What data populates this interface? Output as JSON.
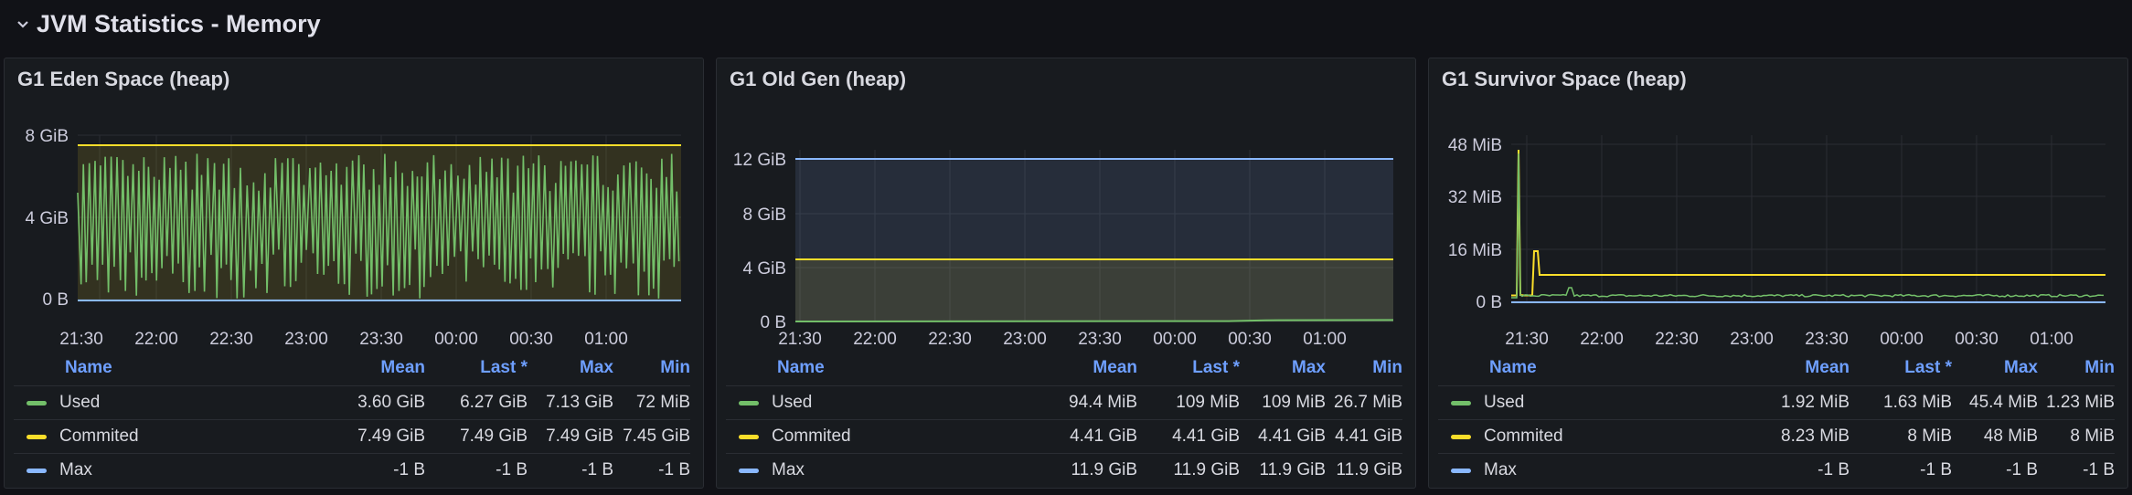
{
  "row": {
    "title": "JVM Statistics - Memory",
    "collapse_icon": "chevron-down-icon"
  },
  "legend_headers": {
    "name": "Name",
    "mean": "Mean",
    "last": "Last *",
    "max": "Max",
    "min": "Min"
  },
  "colors": {
    "used": "#73bf69",
    "commited": "#fade2a",
    "max": "#8ab8ff",
    "grid": "#2a2d33",
    "bg": "#181b1f"
  },
  "x_ticks": [
    "21:30",
    "22:00",
    "22:30",
    "23:00",
    "23:30",
    "00:00",
    "00:30",
    "01:00"
  ],
  "panels": [
    {
      "title": "G1 Eden Space (heap)",
      "y_ticks": [
        "8 GiB",
        "4 GiB",
        "0 B"
      ],
      "rows": [
        {
          "name": "Used",
          "mean": "3.60 GiB",
          "last": "6.27 GiB",
          "max": "7.13 GiB",
          "min": "72 MiB"
        },
        {
          "name": "Commited",
          "mean": "7.49 GiB",
          "last": "7.49 GiB",
          "max": "7.49 GiB",
          "min": "7.45 GiB"
        },
        {
          "name": "Max",
          "mean": "-1 B",
          "last": "-1 B",
          "max": "-1 B",
          "min": "-1 B"
        }
      ]
    },
    {
      "title": "G1 Old Gen (heap)",
      "y_ticks": [
        "12 GiB",
        "8 GiB",
        "4 GiB",
        "0 B"
      ],
      "rows": [
        {
          "name": "Used",
          "mean": "94.4 MiB",
          "last": "109 MiB",
          "max": "109 MiB",
          "min": "26.7 MiB"
        },
        {
          "name": "Commited",
          "mean": "4.41 GiB",
          "last": "4.41 GiB",
          "max": "4.41 GiB",
          "min": "4.41 GiB"
        },
        {
          "name": "Max",
          "mean": "11.9 GiB",
          "last": "11.9 GiB",
          "max": "11.9 GiB",
          "min": "11.9 GiB"
        }
      ]
    },
    {
      "title": "G1 Survivor Space (heap)",
      "y_ticks": [
        "48 MiB",
        "32 MiB",
        "16 MiB",
        "0 B"
      ],
      "rows": [
        {
          "name": "Used",
          "mean": "1.92 MiB",
          "last": "1.63 MiB",
          "max": "45.4 MiB",
          "min": "1.23 MiB"
        },
        {
          "name": "Commited",
          "mean": "8.23 MiB",
          "last": "8 MiB",
          "max": "48 MiB",
          "min": "8 MiB"
        },
        {
          "name": "Max",
          "mean": "-1 B",
          "last": "-1 B",
          "max": "-1 B",
          "min": "-1 B"
        }
      ]
    }
  ]
}
